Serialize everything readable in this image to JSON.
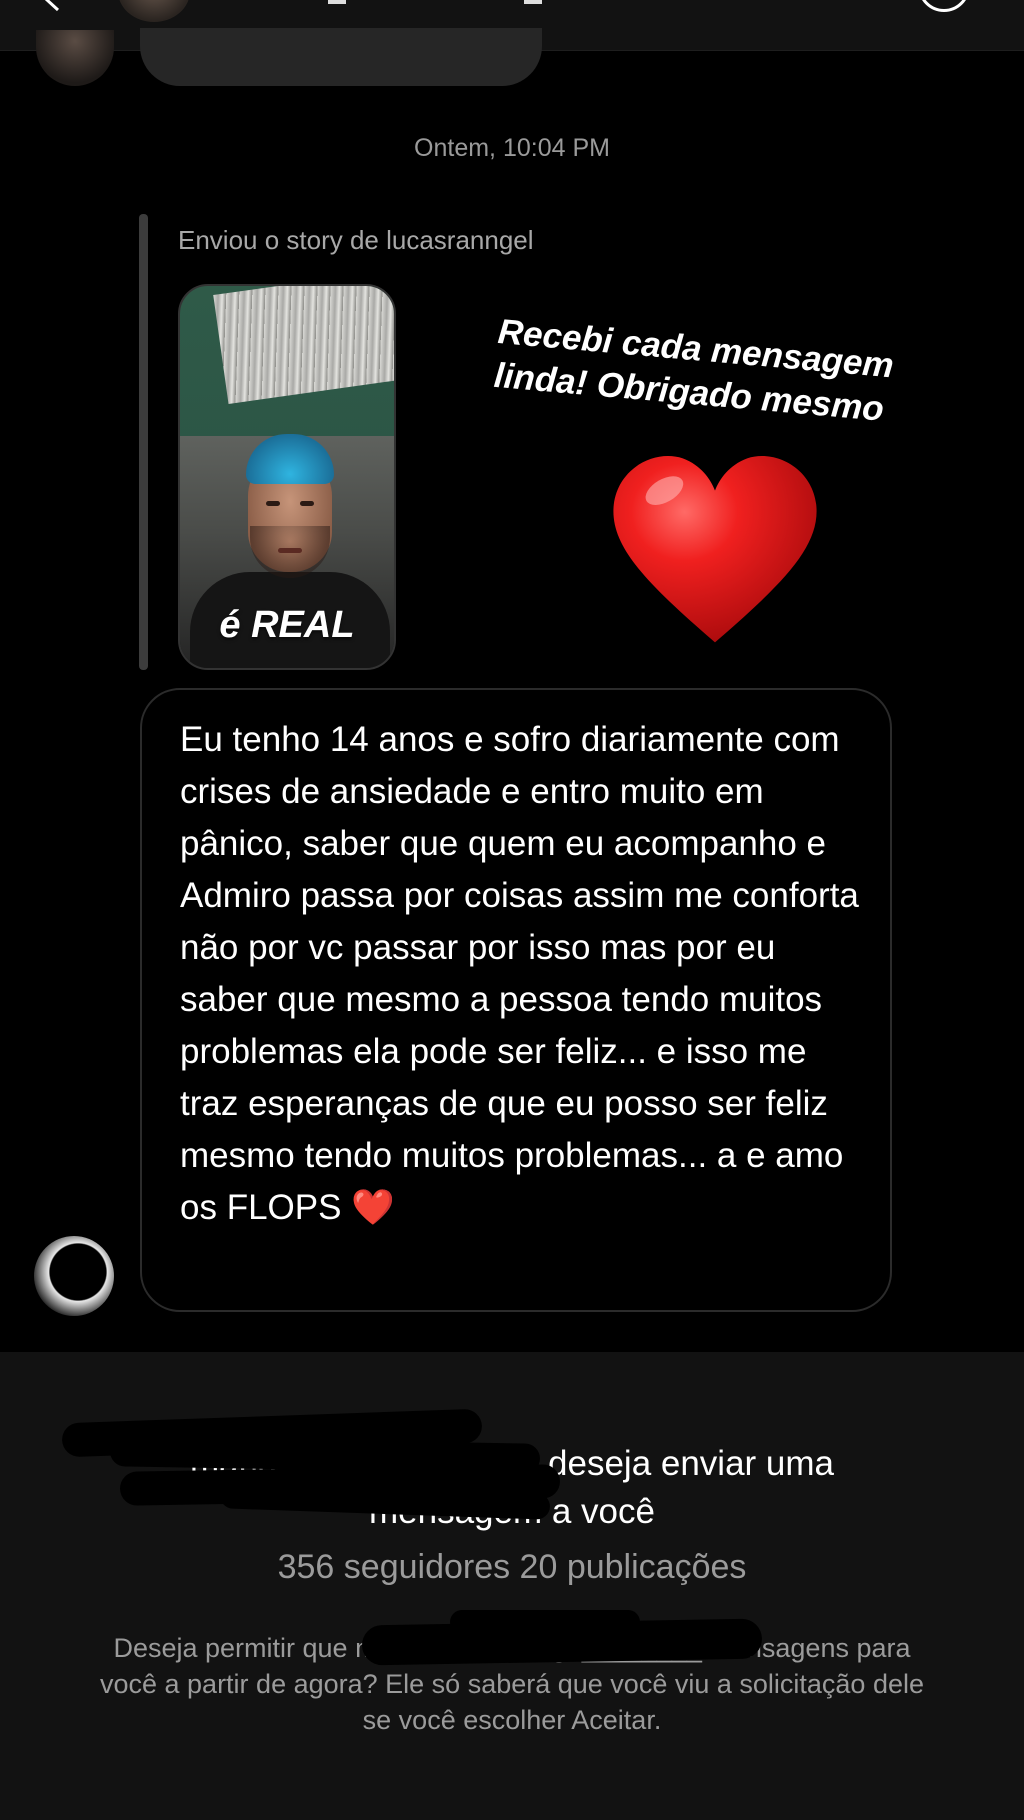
{
  "header": {
    "back_icon": "chevron-left-icon",
    "info_icon": "info-circle-icon"
  },
  "conversation": {
    "timestamp": "Ontem, 10:04 PM",
    "story_reply": {
      "caption": "Enviou o story de lucasranngel",
      "thumbnail_label": "é REAL",
      "sticker_text": "Recebi cada mensagem linda! Obrigado mesmo",
      "sticker_icon": "red-heart-icon"
    },
    "message": {
      "text": "Eu tenho 14 anos e sofro diariamente com crises de ansiedade e entro muito em pânico, saber que quem eu acompanho e Admiro passa por coisas assim me conforta não por vc passar por isso mas por eu saber que mesmo a pessoa tendo muitos problemas ela pode ser feliz... e isso me traz esperanças de que eu posso ser feliz mesmo tendo muitos problemas... a e amo os FLOPS ❤️"
    }
  },
  "request": {
    "title_line1": "maria_______ada_loo deseja enviar uma",
    "title_line2": "mensagem a você",
    "stats": "356 seguidores 20 publicações",
    "description": "Deseja permitir que m____ __tornanga________ mensagens para você a partir de agora? Ele só saberá que você viu a solicitação dele se você escolher Aceitar."
  },
  "colors": {
    "background": "#000000",
    "panel": "#121212",
    "secondary_text": "#9b9b9b",
    "heart": "#e0151b"
  }
}
